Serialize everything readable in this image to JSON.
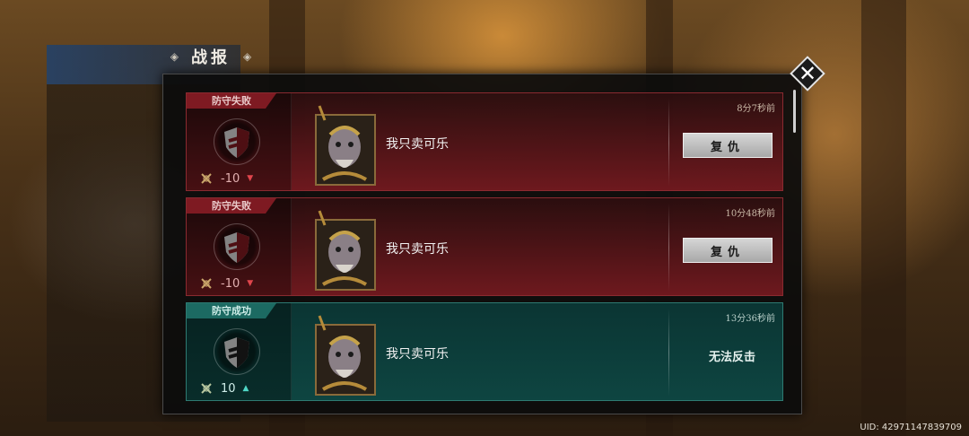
{
  "header": {
    "title": "战报"
  },
  "reports": [
    {
      "result": "防守失败",
      "outcome": "fail",
      "score": "-10",
      "trend": "down",
      "player": "我只卖可乐",
      "time": "8分7秒前",
      "action": {
        "type": "button",
        "label": "复仇"
      }
    },
    {
      "result": "防守失败",
      "outcome": "fail",
      "score": "-10",
      "trend": "down",
      "player": "我只卖可乐",
      "time": "10分48秒前",
      "action": {
        "type": "button",
        "label": "复仇"
      }
    },
    {
      "result": "防守成功",
      "outcome": "win",
      "score": "10",
      "trend": "up",
      "player": "我只卖可乐",
      "time": "13分36秒前",
      "action": {
        "type": "text",
        "label": "无法反击"
      }
    }
  ],
  "footer": {
    "uid": "UID: 42971147839709"
  },
  "colors": {
    "fail": "#7e1a22",
    "win": "#1c6a62",
    "trend_down": "#e0454c",
    "trend_up": "#4fd6c5"
  }
}
